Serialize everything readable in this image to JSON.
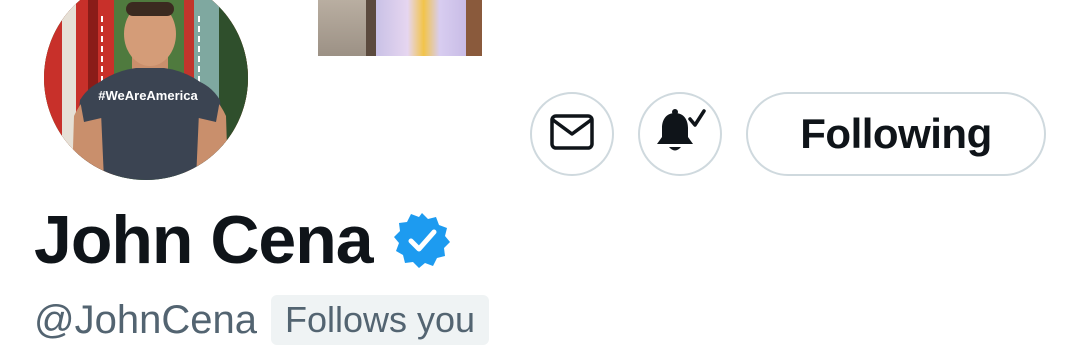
{
  "profile": {
    "display_name": "John Cena",
    "handle": "@JohnCena",
    "follows_you_label": "Follows you",
    "verified": true,
    "avatar_shirt_text": "#WeAreAmerica"
  },
  "actions": {
    "message_icon": "envelope-icon",
    "notify_icon": "bell-check-icon",
    "follow_label": "Following"
  },
  "colors": {
    "text_primary": "#0f1419",
    "text_secondary": "#536471",
    "verified_blue": "#1d9bf0",
    "button_border": "#cfd9de",
    "badge_bg": "#eff3f4"
  }
}
